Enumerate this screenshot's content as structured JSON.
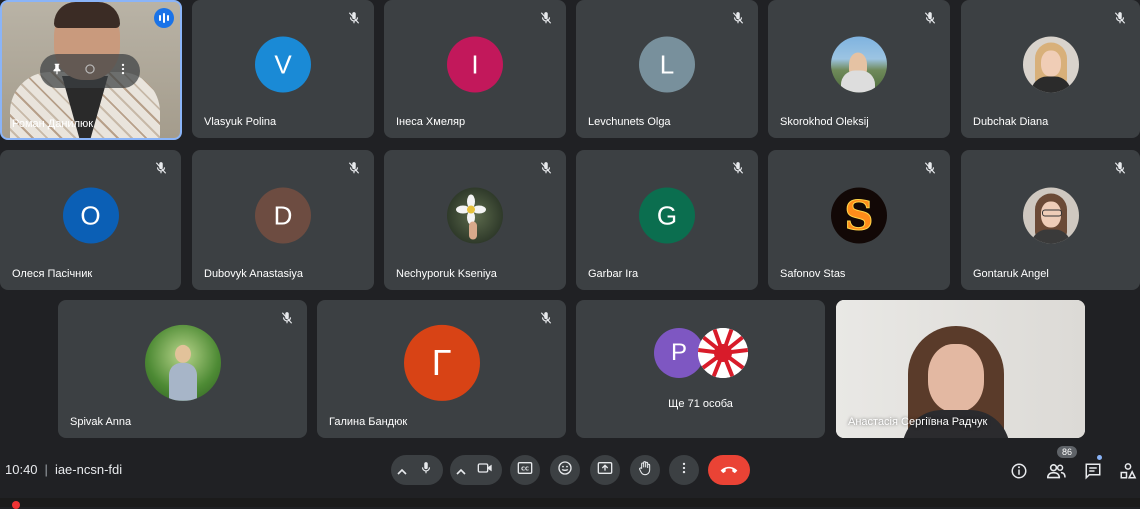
{
  "participants_row1": [
    {
      "name": "Роман Данилюк",
      "self": true
    },
    {
      "name": "Vlasyuk Polina",
      "initial": "V",
      "color": "#1a8ad6"
    },
    {
      "name": "Інеса Хмеляр",
      "initial": "I",
      "color": "#c2185b"
    },
    {
      "name": "Levchunets Olga",
      "initial": "L",
      "color": "#78909c"
    },
    {
      "name": "Skorokhod Oleksij",
      "photo": "landscape-photo"
    },
    {
      "name": "Dubchak Diana",
      "photo": "portrait-photo"
    }
  ],
  "participants_row2": [
    {
      "name": "Олеся Пасічник",
      "initial": "О",
      "color": "#0b5fb5"
    },
    {
      "name": "Dubovyk Anastasiya",
      "initial": "D",
      "color": "#6d4c41"
    },
    {
      "name": "Nechyporuk Kseniya",
      "photo": "flower-photo"
    },
    {
      "name": "Garbar Ira",
      "initial": "G",
      "color": "#0b6e4f"
    },
    {
      "name": "Safonov Stas",
      "photo": "fire-letter-s"
    },
    {
      "name": "Gontaruk Angel",
      "photo": "portrait-photo"
    }
  ],
  "participants_row3": [
    {
      "name": "Spivak Anna",
      "photo": "park-photo"
    },
    {
      "name": "Галина Бандюк",
      "initial": "Г",
      "color": "#d84315"
    },
    {
      "name": "Ще 71 особа",
      "initial": "P",
      "color": "#7e57c2"
    },
    {
      "name": "Анастасія Сергіївна Радчук",
      "video": true
    }
  ],
  "meeting": {
    "time": "10:40",
    "code": "iae-ncsn-fdi",
    "participant_count": "86"
  },
  "colors": {
    "background": "#202124",
    "tile": "#3c4043",
    "end_call": "#ea4335",
    "accent": "#8ab4f8"
  },
  "icons": {
    "controls": [
      "microphone-icon",
      "camera-icon",
      "captions-icon",
      "emoji-icon",
      "present-icon",
      "raise-hand-icon",
      "more-options-icon",
      "end-call-icon"
    ],
    "right": [
      "info-icon",
      "people-icon",
      "chat-icon",
      "activities-icon"
    ]
  }
}
